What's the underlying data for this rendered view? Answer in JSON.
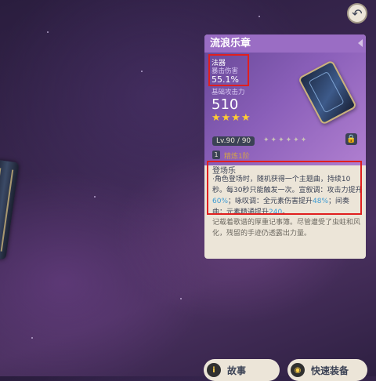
{
  "weapon": {
    "name": "流浪乐章",
    "stat_type": "法器",
    "stat_name": "暴击伤害",
    "stat_value": "55.1%",
    "base_label": "基础攻击力",
    "base_value": "510",
    "stars": "★★★★",
    "level": "Lv.90 / 90",
    "level_dots": "✦✦✦✦✦✦",
    "refine_num": "1",
    "refine_text": "精炼1阶",
    "ability_name": "登场乐",
    "ability_p1": "·角色登场时，随机获得一个主题曲，持续10秒。每30秒只能触发一次。宣叙调：攻击力提升",
    "ability_v1": "60%",
    "ability_p2": "；咏叹调：全元素伤害提升",
    "ability_v2": "48%",
    "ability_p3": "；间奏曲：元素精通提升",
    "ability_v3": "240",
    "ability_p4": "。",
    "lore": "记载着歌谱的厚重记事簿。尽管遭受了虫蛀和风化，残留的手迹仍透露出力量。"
  },
  "icons": {
    "back": "↶",
    "lock": "🔒",
    "story": "i",
    "equip": "◉"
  },
  "buttons": {
    "story_label": "故事",
    "equip_label": "快速装备"
  },
  "colors": {
    "header": "#9a6dc4",
    "card_bg": "#ece5d8",
    "highlight": "#3d9bd3",
    "star": "#ffcc32",
    "red_annotation": "#e01f1f"
  }
}
